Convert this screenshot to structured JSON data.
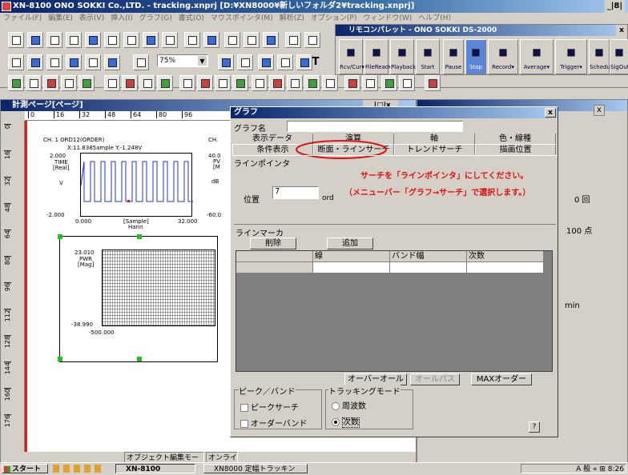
{
  "app": {
    "title": "XN-8100 ONO SOKKI Co.,LTD. - tracking.xnprj [D:¥XN8000¥新しいフォルダ2¥tracking.xnprj]",
    "win_btns": "_|8|",
    "menu": [
      "ファイル(F)",
      "編集(E)",
      "表示(V)",
      "挿入(I)",
      "グラフ(G)",
      "書式(O)",
      "マウスポインタ(M)",
      "解析(Z)",
      "オプション(P)",
      "ウィンドウ(W)",
      "ヘルプ(H)"
    ],
    "zoom": "75%",
    "tool_t": "T"
  },
  "remote": {
    "title": "リモコンパレット - ONO SOKKI DS-2000",
    "close": "x",
    "buttons": [
      "Rcv/Cur▾",
      "FileRead▾",
      "Playback",
      "Start",
      "Pause",
      "Stop",
      "Record▾",
      "Average▾",
      "Trigger▾",
      "Schedule▾",
      "SigOut▾"
    ]
  },
  "calc": {
    "title": "計測ページ[ページ]",
    "ruler": [
      "0",
      "16",
      "32",
      "48",
      "64",
      "80",
      "96"
    ],
    "vruler": [
      "0",
      "16",
      "32",
      "48",
      "64",
      "80",
      "96",
      "112",
      "128",
      "144",
      "160",
      "176"
    ],
    "wave_title": "CH. 1 ORD12(ORDER)",
    "wave_cursor": "X:11.8385ample  Y:-1.248V",
    "wave_y": [
      "2.000",
      "TIME",
      "[Real]",
      "V",
      "-2.000"
    ],
    "wave_x": [
      "0.000",
      "[Sample]",
      "Hann",
      "32.000"
    ],
    "ch_right": "CH.",
    "ch_right_y": [
      "40.0",
      "PV",
      "[M",
      "dB",
      "-60.0"
    ],
    "spec_y": [
      "23.010",
      "PWR",
      "[Mag]",
      "-38.990"
    ],
    "spec_x": "-500.000",
    "status": [
      "オブジェクト編集モード",
      "オンライン"
    ]
  },
  "graph_dialog": {
    "title": "グラフ",
    "close": "x",
    "name_label": "グラフ名",
    "name_value": "",
    "tabs_row1": [
      "表示データ",
      "演算",
      "軸",
      "色・線種"
    ],
    "tabs_row2": [
      "条件表示",
      "断面・ラインサーチ",
      "トレンドサーチ",
      "描画位置"
    ],
    "pointer_group": "ラインポインタ",
    "pos_label": "位置",
    "pos_value": "7",
    "pos_unit": "ord",
    "note1": "サーチを「ラインポインタ」にしてください。",
    "note2": "（メニューバー「グラフ→サーチ」で選択します。）",
    "marker_group": "ラインマーカ",
    "del_btn": "削除",
    "add_btn": "追加",
    "cols": [
      "線",
      "バンド幅",
      "次数"
    ],
    "overall_btn": "オーバーオール",
    "allpass_btn": "オールパス",
    "maxorder_btn": "MAXオーダー",
    "peak_group": "ピーク／バンド",
    "peak_search": "ピークサーチ",
    "order_band": "オーダーバンド",
    "track_group": "トラッキングモード",
    "track_freq": "周波数",
    "track_order": "次数",
    "help": "?"
  },
  "side": {
    "count": "0 回",
    "points": "100 点",
    "min": "min",
    "close": "x",
    "min_btn": "_|□|x"
  },
  "taskbar": {
    "start": "スタート",
    "task1": "XN-8100",
    "task2": "XN8000 定幅トラッキング...",
    "tray": "A 般 « ⊞ 8:26"
  }
}
